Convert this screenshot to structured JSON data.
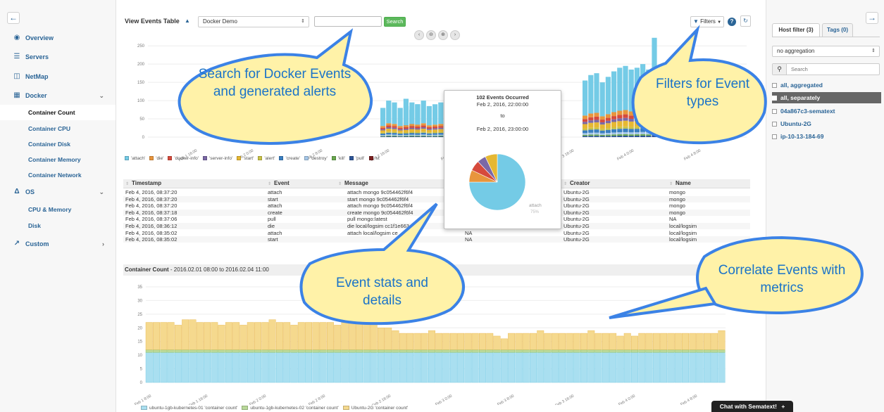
{
  "sidebar": {
    "collapse_icon": "arrow-left-icon",
    "items": [
      {
        "label": "Overview",
        "icon": "binoculars-icon"
      },
      {
        "label": "Servers",
        "icon": "server-list-icon"
      },
      {
        "label": "NetMap",
        "icon": "netmap-icon"
      },
      {
        "label": "Docker",
        "icon": "docker-icon"
      },
      {
        "label": "OS",
        "icon": "linux-icon"
      },
      {
        "label": "Custom",
        "icon": "wrench-icon"
      }
    ],
    "docker_sub": [
      "Container Count",
      "Container CPU",
      "Container Disk",
      "Container Memory",
      "Container Network"
    ],
    "os_sub": [
      "CPU & Memory",
      "Disk"
    ],
    "active_item": "Container Count"
  },
  "toolbar": {
    "title": "View Events Table",
    "app_select": "Docker Demo",
    "search_value": "",
    "search_button": "Search",
    "filters_label": "Filters"
  },
  "events_chart": {
    "x_ticks": [
      "Feb 1 16:00",
      "Feb 2 0:00",
      "Feb 2 8:00",
      "Feb 2 16:00",
      "Feb 3 0:00",
      "Feb 3 8:00",
      "Feb 3 16:00",
      "Feb 4 0:00",
      "Feb 4 8:00"
    ],
    "y_ticks": [
      "0",
      "50",
      "100",
      "150",
      "200",
      "250"
    ],
    "legend": [
      "'attach'",
      "'die'",
      "'docker-info'",
      "'server-info'",
      "'start'",
      "'alert'",
      "'create'",
      "'destroy'",
      "'kill'",
      "'pull'",
      "'st"
    ],
    "legend_colors": [
      "#74cbe6",
      "#e8953c",
      "#d64a3c",
      "#7b68a6",
      "#e6b833",
      "#c9c246",
      "#3a7fc1",
      "#a6c7e8",
      "#6aa84f",
      "#2f5597",
      "#7a1f1f"
    ]
  },
  "events_table": {
    "columns": [
      "Timestamp",
      "Event",
      "Message",
      "",
      "Creator",
      "Name"
    ],
    "rows": [
      [
        "Feb 4, 2016, 08:37:20",
        "attach",
        "attach mongo 9c054462f6f4",
        "",
        "Ubuntu-2G",
        "mongo"
      ],
      [
        "Feb 4, 2016, 08:37:20",
        "start",
        "start mongo 9c054462f6f4",
        "",
        "Ubuntu-2G",
        "mongo"
      ],
      [
        "Feb 4, 2016, 08:37:20",
        "attach",
        "attach mongo 9c054462f6f4",
        "",
        "Ubuntu-2G",
        "mongo"
      ],
      [
        "Feb 4, 2016, 08:37:18",
        "create",
        "create mongo 9c054462f6f4",
        "",
        "Ubuntu-2G",
        "mongo"
      ],
      [
        "Feb 4, 2016, 08:37:06",
        "pull",
        "pull mongo:latest",
        "",
        "Ubuntu-2G",
        "NA"
      ],
      [
        "Feb 4, 2016, 08:36:12",
        "die",
        "die local/logsim cc1f1e663",
        "NA",
        "Ubuntu-2G",
        "local/logsim"
      ],
      [
        "Feb 4, 2016, 08:35:02",
        "attach",
        "attach local/logsim ce",
        "NA",
        "Ubuntu-2G",
        "local/logsim"
      ],
      [
        "Feb 4, 2016, 08:35:02",
        "start",
        "",
        "NA",
        "Ubuntu-2G",
        "local/logsim"
      ]
    ]
  },
  "popup": {
    "title": "102 Events Occurred",
    "from": "Feb 2, 2016, 22:00:00",
    "to_label": "to",
    "to": "Feb 2, 2016, 23:00:00",
    "slice_label": "attach",
    "slice_pct": "75%"
  },
  "container_count": {
    "title": "Container Count",
    "range": " - 2016.02.01 08:00 to 2016.02.04 11:00",
    "y_ticks": [
      "0",
      "5",
      "10",
      "15",
      "20",
      "25",
      "30",
      "35"
    ],
    "x_ticks": [
      "Feb 1 8:00",
      "Feb 1 16:00",
      "Feb 2 0:00",
      "Feb 2 8:00",
      "Feb 2 16:00",
      "Feb 3 0:00",
      "Feb 3 8:00",
      "Feb 3 16:00",
      "Feb 4 0:00",
      "Feb 4 8:00"
    ],
    "legend": [
      "ubuntu-1gb-kubernetes-01 'container count'",
      "ubuntu-1gb-kubernetes-02 'container count'",
      "Ubuntu-2G 'container count'"
    ]
  },
  "right_panel": {
    "tab_host": "Host filter (3)",
    "tab_tags": "Tags (0)",
    "aggregation": "no aggregation",
    "search_placeholder": "Search",
    "hosts": [
      "all, aggregated",
      "all, separately",
      "04a867c3-sematext",
      "Ubuntu-2G",
      "ip-10-13-184-69"
    ]
  },
  "callouts": {
    "search": "Search for Docker Events and generated alerts",
    "filters": "Filters for Event types",
    "stats": "Event stats and details",
    "correlate": "Correlate Events with metrics"
  },
  "chat": {
    "label": "Chat with Sematext!"
  },
  "chart_data": [
    {
      "type": "bar",
      "title": "",
      "xlabel": "",
      "ylabel": "",
      "ylim": [
        0,
        260
      ],
      "note": "stacked event counts per hour, values estimated",
      "series_names": [
        "'attach'",
        "'die'",
        "'docker-info'",
        "'server-info'",
        "'start'",
        "'alert'",
        "'create'",
        "'destroy'",
        "'kill'",
        "'pull'"
      ],
      "groups": [
        {
          "from": "Feb 2 13:00",
          "values": [
            80,
            100,
            95,
            80,
            105,
            75,
            90
          ]
        },
        {
          "from": "Feb 2 21:00",
          "values": [
            85,
            95,
            90,
            100,
            85,
            90,
            95,
            80,
            100,
            90,
            60,
            102,
            95,
            90
          ]
        },
        {
          "from": "Feb 3 22:00",
          "values": [
            155,
            170,
            175,
            150,
            165,
            180,
            190,
            195,
            185,
            190,
            200,
            185,
            272,
            150
          ]
        }
      ],
      "isolated": [
        {
          "x": "Feb 4 6:00",
          "value": 5
        }
      ]
    },
    {
      "type": "pie",
      "title": "102 Events Occurred",
      "labels": [
        "attach",
        "die",
        "docker-info",
        "server-info",
        "start"
      ],
      "values": [
        75,
        7,
        6,
        5,
        7
      ]
    },
    {
      "type": "bar",
      "title": "Container Count",
      "xlabel": "",
      "ylabel": "",
      "ylim": [
        0,
        35
      ],
      "series": [
        {
          "name": "ubuntu-1gb-kubernetes-01 'container count'",
          "values": [
            11,
            11,
            11,
            11,
            11,
            11,
            11,
            11,
            11,
            11,
            11,
            11,
            11,
            11,
            11,
            11,
            11,
            11,
            11,
            11,
            11,
            11,
            11,
            11,
            11,
            11,
            11,
            11,
            11,
            11,
            11,
            11,
            11,
            11,
            11,
            11,
            11,
            11,
            11,
            11,
            11,
            11,
            11,
            11,
            11,
            11,
            11,
            11,
            11,
            11,
            11,
            11,
            11,
            11,
            11,
            11,
            11,
            11,
            11,
            11,
            11,
            11,
            11,
            11,
            11,
            11,
            11,
            11,
            11,
            11,
            11,
            11,
            11,
            11,
            11,
            11,
            11,
            11,
            11,
            11
          ]
        },
        {
          "name": "ubuntu-1gb-kubernetes-02 'container count'",
          "values": [
            1,
            1,
            1,
            1,
            1,
            1,
            1,
            1,
            1,
            1,
            1,
            1,
            1,
            1,
            1,
            1,
            1,
            1,
            1,
            1,
            1,
            1,
            1,
            1,
            1,
            1,
            1,
            1,
            1,
            1,
            1,
            1,
            1,
            1,
            1,
            1,
            1,
            1,
            1,
            1,
            1,
            1,
            1,
            1,
            1,
            1,
            1,
            1,
            1,
            1,
            1,
            1,
            1,
            1,
            1,
            1,
            1,
            1,
            1,
            1,
            1,
            1,
            1,
            1,
            1,
            1,
            1,
            1,
            1,
            1,
            1,
            1,
            1,
            1,
            1,
            1,
            1,
            1,
            1,
            1
          ]
        },
        {
          "name": "Ubuntu-2G 'container count'",
          "values": [
            10,
            10,
            10,
            10,
            9,
            11,
            11,
            10,
            10,
            10,
            9,
            10,
            10,
            9,
            10,
            10,
            10,
            11,
            10,
            10,
            9,
            10,
            10,
            10,
            10,
            10,
            9,
            10,
            10,
            10,
            10,
            10,
            8,
            8,
            7,
            6,
            6,
            6,
            6,
            7,
            6,
            6,
            6,
            6,
            6,
            6,
            6,
            6,
            5,
            4,
            6,
            6,
            6,
            6,
            7,
            6,
            6,
            6,
            6,
            6,
            6,
            7,
            6,
            6,
            6,
            5,
            6,
            5,
            6,
            6,
            6,
            6,
            6,
            6,
            6,
            6,
            6,
            6,
            6,
            7
          ]
        }
      ]
    }
  ]
}
